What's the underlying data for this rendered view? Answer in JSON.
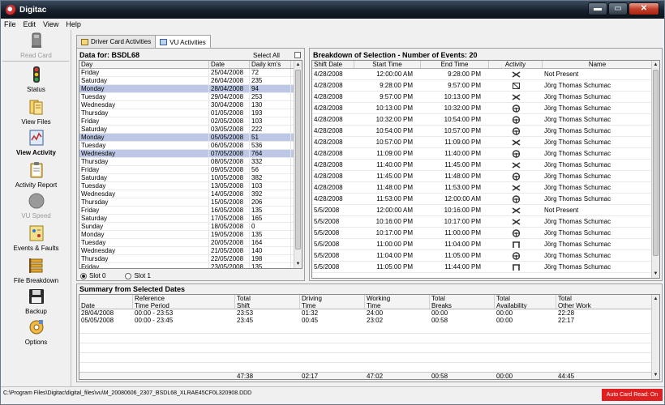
{
  "window": {
    "title": "Digitac",
    "minimize": "▬",
    "maximize": "▭",
    "close": "✕"
  },
  "menu": [
    "File",
    "Edit",
    "View",
    "Help"
  ],
  "sidebar": {
    "items": [
      {
        "label": "Read Card",
        "icon": "card-reader-icon"
      },
      {
        "label": "Status",
        "icon": "traffic-light-icon"
      },
      {
        "label": "View Files",
        "icon": "files-icon"
      },
      {
        "label": "View Activity",
        "icon": "activity-icon"
      },
      {
        "label": "Activity Report",
        "icon": "clipboard-icon"
      },
      {
        "label": "VU Speed",
        "icon": "speed-icon"
      },
      {
        "label": "Events & Faults",
        "icon": "events-icon"
      },
      {
        "label": "File Breakdown",
        "icon": "breakdown-icon"
      },
      {
        "label": "Backup",
        "icon": "floppy-icon"
      },
      {
        "label": "Options",
        "icon": "options-icon"
      }
    ]
  },
  "tabs": [
    {
      "label": "Driver Card Activities"
    },
    {
      "label": "VU Activities"
    }
  ],
  "left_panel": {
    "title": "Data for: BSDL68",
    "select_all": "Select All",
    "headers": [
      "Day",
      "Date",
      "Daily km's"
    ],
    "rows": [
      [
        "Friday",
        "25/04/2008",
        "72"
      ],
      [
        "Saturday",
        "26/04/2008",
        "235"
      ],
      [
        "Monday",
        "28/04/2008",
        "94"
      ],
      [
        "Tuesday",
        "29/04/2008",
        "253"
      ],
      [
        "Wednesday",
        "30/04/2008",
        "130"
      ],
      [
        "Thursday",
        "01/05/2008",
        "193"
      ],
      [
        "Friday",
        "02/05/2008",
        "103"
      ],
      [
        "Saturday",
        "03/05/2008",
        "222"
      ],
      [
        "Monday",
        "05/05/2008",
        "51"
      ],
      [
        "Tuesday",
        "06/05/2008",
        "536"
      ],
      [
        "Wednesday",
        "07/05/2008",
        "764"
      ],
      [
        "Thursday",
        "08/05/2008",
        "332"
      ],
      [
        "Friday",
        "09/05/2008",
        "56"
      ],
      [
        "Saturday",
        "10/05/2008",
        "382"
      ],
      [
        "Tuesday",
        "13/05/2008",
        "103"
      ],
      [
        "Wednesday",
        "14/05/2008",
        "392"
      ],
      [
        "Thursday",
        "15/05/2008",
        "206"
      ],
      [
        "Friday",
        "16/05/2008",
        "135"
      ],
      [
        "Saturday",
        "17/05/2008",
        "165"
      ],
      [
        "Sunday",
        "18/05/2008",
        "0"
      ],
      [
        "Monday",
        "19/05/2008",
        "135"
      ],
      [
        "Tuesday",
        "20/05/2008",
        "164"
      ],
      [
        "Wednesday",
        "21/05/2008",
        "140"
      ],
      [
        "Thursday",
        "22/05/2008",
        "198"
      ],
      [
        "Friday",
        "23/05/2008",
        "135"
      ]
    ],
    "selected_rows": [
      2,
      8,
      10
    ],
    "slot0": "Slot 0",
    "slot1": "Slot 1"
  },
  "right_panel": {
    "title": "Breakdown of Selection - Number of Events: 20",
    "headers": [
      "Shift Date",
      "Start Time",
      "End Time",
      "Activity",
      "Name"
    ],
    "rows": [
      [
        "4/28/2008",
        "12:00:00 AM",
        "9:28:00 PM",
        "rest",
        "Not Present"
      ],
      [
        "4/28/2008",
        "9:28:00 PM",
        "9:57:00 PM",
        "available",
        "Jörg Thomas Schumac"
      ],
      [
        "4/28/2008",
        "9:57:00 PM",
        "10:13:00 PM",
        "rest",
        "Jörg Thomas Schumac"
      ],
      [
        "4/28/2008",
        "10:13:00 PM",
        "10:32:00 PM",
        "driving",
        "Jörg Thomas Schumac"
      ],
      [
        "4/28/2008",
        "10:32:00 PM",
        "10:54:00 PM",
        "driving",
        "Jörg Thomas Schumac"
      ],
      [
        "4/28/2008",
        "10:54:00 PM",
        "10:57:00 PM",
        "driving",
        "Jörg Thomas Schumac"
      ],
      [
        "4/28/2008",
        "10:57:00 PM",
        "11:09:00 PM",
        "rest",
        "Jörg Thomas Schumac"
      ],
      [
        "4/28/2008",
        "11:09:00 PM",
        "11:40:00 PM",
        "driving",
        "Jörg Thomas Schumac"
      ],
      [
        "4/28/2008",
        "11:40:00 PM",
        "11:45:00 PM",
        "rest",
        "Jörg Thomas Schumac"
      ],
      [
        "4/28/2008",
        "11:45:00 PM",
        "11:48:00 PM",
        "driving",
        "Jörg Thomas Schumac"
      ],
      [
        "4/28/2008",
        "11:48:00 PM",
        "11:53:00 PM",
        "rest",
        "Jörg Thomas Schumac"
      ],
      [
        "4/28/2008",
        "11:53:00 PM",
        "12:00:00 AM",
        "driving",
        "Jörg Thomas Schumac"
      ],
      [
        "5/5/2008",
        "12:00:00 AM",
        "10:16:00 PM",
        "rest",
        "Not Present"
      ],
      [
        "5/5/2008",
        "10:16:00 PM",
        "10:17:00 PM",
        "rest",
        "Jörg Thomas Schumac"
      ],
      [
        "5/5/2008",
        "10:17:00 PM",
        "11:00:00 PM",
        "driving",
        "Jörg Thomas Schumac"
      ],
      [
        "5/5/2008",
        "11:00:00 PM",
        "11:04:00 PM",
        "work",
        "Jörg Thomas Schumac"
      ],
      [
        "5/5/2008",
        "11:04:00 PM",
        "11:05:00 PM",
        "driving",
        "Jörg Thomas Schumac"
      ],
      [
        "5/5/2008",
        "11:05:00 PM",
        "11:44:00 PM",
        "work",
        "Jörg Thomas Schumac"
      ]
    ]
  },
  "summary": {
    "title": "Summary from Selected Dates",
    "header_top": [
      "",
      "Reference",
      "Total",
      "Driving",
      "Working",
      "Total",
      "Total",
      "Total"
    ],
    "header_bottom": [
      "Date",
      "Time Period",
      "Shift",
      "Time",
      "Time",
      "Breaks",
      "Availability",
      "Other Work"
    ],
    "rows": [
      [
        "28/04/2008",
        "00:00 - 23:53",
        "23:53",
        "01:32",
        "24:00",
        "00:00",
        "00:00",
        "22:28"
      ],
      [
        "05/05/2008",
        "00:00 - 23:45",
        "23:45",
        "00:45",
        "23:02",
        "00:58",
        "00:00",
        "22:17"
      ]
    ],
    "totals": [
      "",
      "",
      "47:38",
      "02:17",
      "47:02",
      "00:58",
      "00:00",
      "44:45"
    ]
  },
  "status": {
    "path": "C:\\Program Files\\Digitac\\digital_files\\vu\\M_20080606_2307_BSDL68_XLRAE45CF0L320908.DDD",
    "card_read": "Auto Card Read: On"
  }
}
